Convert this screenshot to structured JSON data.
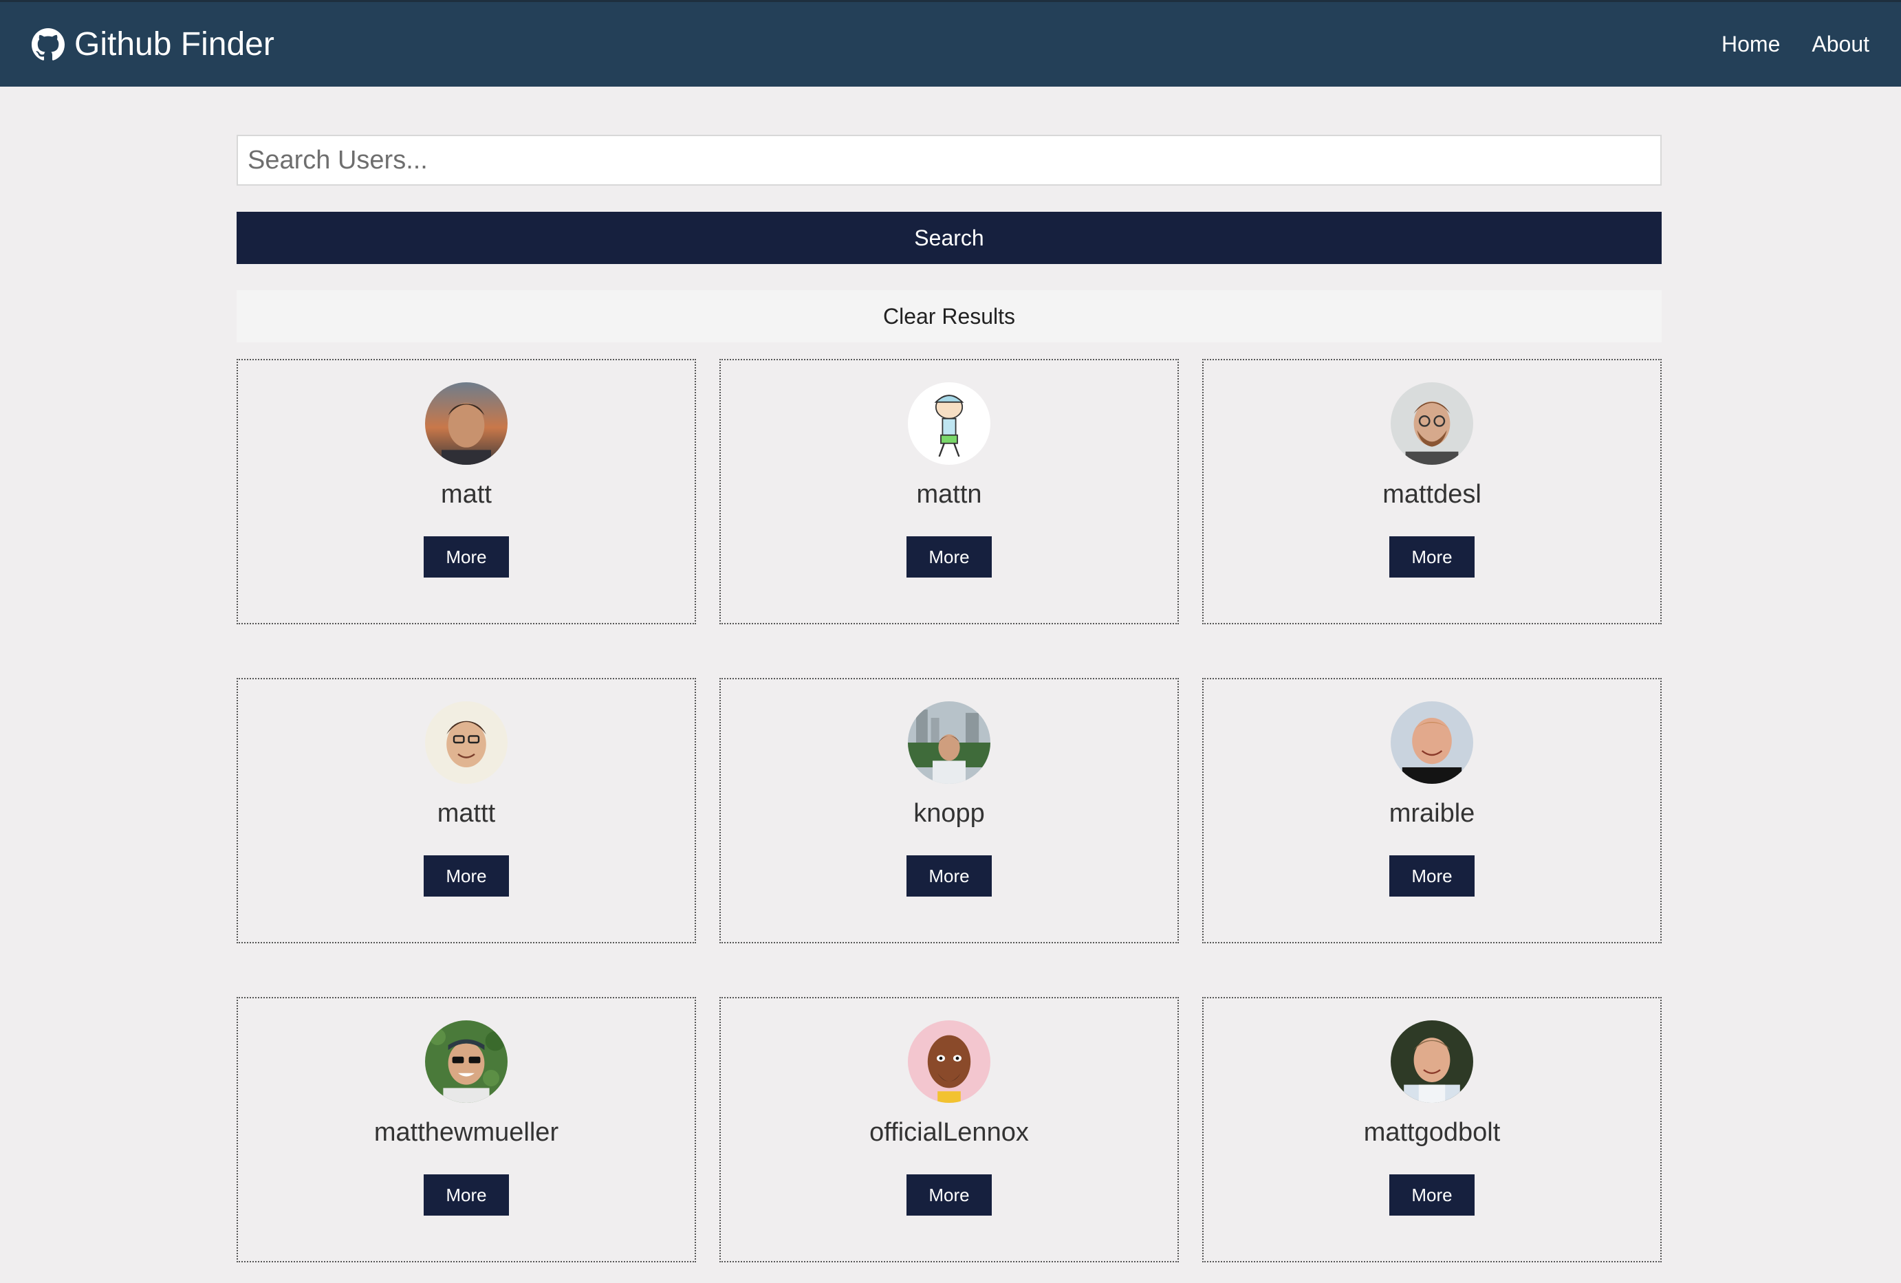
{
  "navbar": {
    "brand": "Github Finder",
    "brand_icon": "github-icon",
    "links": [
      {
        "label": "Home"
      },
      {
        "label": "About"
      }
    ]
  },
  "search": {
    "placeholder": "Search Users...",
    "value": "",
    "search_button": "Search",
    "clear_button": "Clear Results"
  },
  "users": [
    {
      "login": "matt",
      "more": "More",
      "avatar": "portrait-sunset"
    },
    {
      "login": "mattn",
      "more": "More",
      "avatar": "cartoon-character"
    },
    {
      "login": "mattdesl",
      "more": "More",
      "avatar": "portrait-glasses-beard"
    },
    {
      "login": "mattt",
      "more": "More",
      "avatar": "portrait-glasses-smile"
    },
    {
      "login": "knopp",
      "more": "More",
      "avatar": "portrait-city"
    },
    {
      "login": "mraible",
      "more": "More",
      "avatar": "portrait-bald"
    },
    {
      "login": "matthewmueller",
      "more": "More",
      "avatar": "portrait-sunglasses-leaves"
    },
    {
      "login": "officialLennox",
      "more": "More",
      "avatar": "portrait-cartoon-face"
    },
    {
      "login": "mattgodbolt",
      "more": "More",
      "avatar": "portrait-suit"
    }
  ],
  "colors": {
    "navbar_bg": "#244058",
    "primary_dark": "#16203e",
    "page_bg": "#f0eeef",
    "clear_bg": "#f4f4f4"
  }
}
